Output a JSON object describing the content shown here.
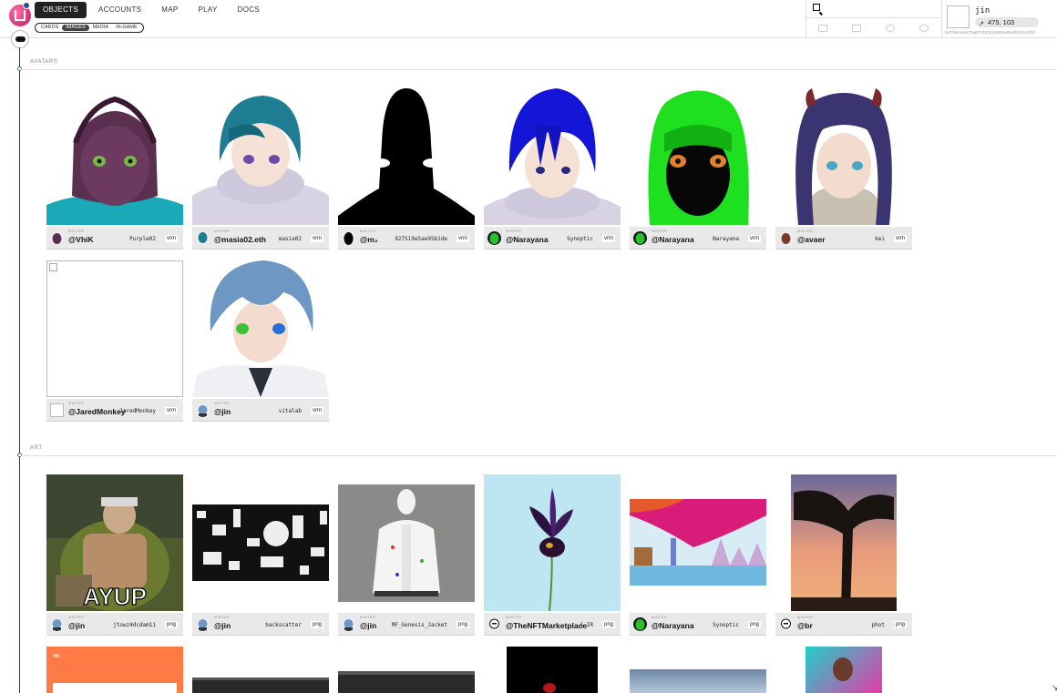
{
  "nav": {
    "tabs": [
      "OBJECTS",
      "ACCOUNTS",
      "MAP",
      "PLAY",
      "DOCS"
    ],
    "active": 0,
    "subtabs": [
      "CARDS",
      "IMAGES",
      "MEDIA",
      "IN-GAME"
    ],
    "sub_active": 1
  },
  "user": {
    "name": "jin",
    "coords": "475, 103",
    "address": "0x37e6ca4c07ae571183224593e90e2f1b34c47ef"
  },
  "sections": {
    "avatars": "AVATARS",
    "art": "ART"
  },
  "minter_label": "MINTER",
  "avatars": [
    {
      "handle": "@VhiK",
      "file": "Purple02",
      "ext": "vrm"
    },
    {
      "handle": "@masia02.eth",
      "file": "masia02",
      "ext": "vrm"
    },
    {
      "handle": "@m₂",
      "file": "927519e5ae9561de",
      "ext": "vrm"
    },
    {
      "handle": "@Narayana",
      "file": "Synoptic",
      "ext": "vrm"
    },
    {
      "handle": "@Narayana",
      "file": "Narayana",
      "ext": "vrm"
    },
    {
      "handle": "@avaer",
      "file": "kei",
      "ext": "vrm"
    },
    {
      "handle": "@JaredMonkey",
      "file": "JaredMonkey",
      "ext": "vrm"
    },
    {
      "handle": "@jin",
      "file": "vitalab",
      "ext": "vrm"
    }
  ],
  "art": [
    {
      "handle": "@jin",
      "file": "jtowz4dcdam11",
      "ext": "png",
      "overlay": "AYUP"
    },
    {
      "handle": "@jin",
      "file": "backscatter",
      "ext": "png"
    },
    {
      "handle": "@jin",
      "file": "MF_Genesis_Jacket",
      "ext": "png"
    },
    {
      "handle": "@TheNFTMarketplace",
      "file": "1_IR",
      "ext": "png"
    },
    {
      "handle": "@Narayana",
      "file": "Synoptic",
      "ext": "png"
    },
    {
      "handle": "@br",
      "file": "phot",
      "ext": "png"
    }
  ],
  "colors": {
    "accent": "#1e6fd9",
    "brand": "#e0306e"
  }
}
